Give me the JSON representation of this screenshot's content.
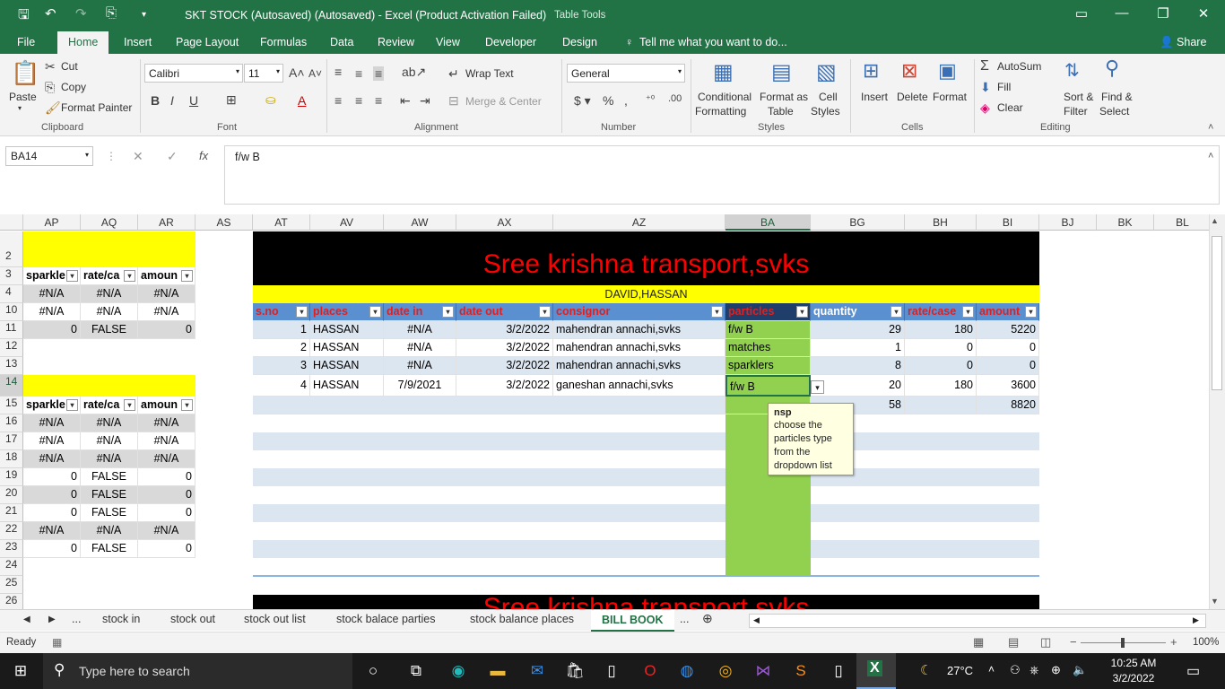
{
  "window": {
    "title": "SKT STOCK (Autosaved) (Autosaved) - Excel (Product Activation Failed)",
    "context_tab": "Table Tools"
  },
  "tabs": [
    "File",
    "Home",
    "Insert",
    "Page Layout",
    "Formulas",
    "Data",
    "Review",
    "View",
    "Developer",
    "Design"
  ],
  "active_tab": "Home",
  "tell_me": "Tell me what you want to do...",
  "share": "Share",
  "ribbon": {
    "clipboard": {
      "paste": "Paste",
      "cut": "Cut",
      "copy": "Copy",
      "format_painter": "Format Painter",
      "group": "Clipboard"
    },
    "font": {
      "name": "Calibri",
      "size": "11",
      "group": "Font"
    },
    "alignment": {
      "wrap": "Wrap Text",
      "merge": "Merge & Center",
      "group": "Alignment"
    },
    "number": {
      "format": "General",
      "group": "Number"
    },
    "styles": {
      "conditional": "Conditional",
      "conditional2": "Formatting",
      "format_as": "Format as",
      "format_as2": "Table",
      "cell": "Cell",
      "cell2": "Styles",
      "group": "Styles"
    },
    "cells": {
      "insert": "Insert",
      "delete": "Delete",
      "format": "Format",
      "group": "Cells"
    },
    "editing": {
      "autosum": "AutoSum",
      "fill": "Fill",
      "clear": "Clear",
      "sort": "Sort &",
      "sort2": "Filter",
      "find": "Find &",
      "find2": "Select",
      "group": "Editing"
    }
  },
  "name_box": "BA14",
  "formula": "f/w B",
  "columns": [
    "AP",
    "AQ",
    "AR",
    "AS",
    "AT",
    "AV",
    "AW",
    "AX",
    "AZ",
    "BA",
    "BG",
    "BH",
    "BI",
    "BJ",
    "BK",
    "BL"
  ],
  "rows": [
    "2",
    "3",
    "4",
    "10",
    "11",
    "12",
    "13",
    "14",
    "15",
    "16",
    "17",
    "18",
    "19",
    "20",
    "21",
    "22",
    "23",
    "24",
    "25",
    "26"
  ],
  "left": {
    "h1": [
      "sparkle",
      "rate/ca",
      "amoun"
    ],
    "r4": [
      "#N/A",
      "#N/A",
      "#N/A"
    ],
    "r10": [
      "#N/A",
      "#N/A",
      "#N/A"
    ],
    "r11": [
      "0",
      "FALSE",
      "0"
    ],
    "h2": [
      "sparkle",
      "rate/ca",
      "amoun"
    ],
    "rows": [
      [
        "#N/A",
        "#N/A",
        "#N/A"
      ],
      [
        "#N/A",
        "#N/A",
        "#N/A"
      ],
      [
        "#N/A",
        "#N/A",
        "#N/A"
      ],
      [
        "0",
        "FALSE",
        "0"
      ],
      [
        "0",
        "FALSE",
        "0"
      ],
      [
        "0",
        "FALSE",
        "0"
      ],
      [
        "#N/A",
        "#N/A",
        "#N/A"
      ],
      [
        "0",
        "FALSE",
        "0"
      ]
    ]
  },
  "bill": {
    "title": "Sree krishna transport,svks",
    "subtitle": "DAVID,HASSAN",
    "headers": [
      "s.no",
      "places",
      "date in",
      "date out",
      "consignor",
      "particles",
      "quantity",
      "rate/case",
      "amount"
    ],
    "rows": [
      [
        "1",
        "HASSAN",
        "#N/A",
        "3/2/2022",
        "mahendran annachi,svks",
        "f/w B",
        "29",
        "180",
        "5220"
      ],
      [
        "2",
        "HASSAN",
        "#N/A",
        "3/2/2022",
        "mahendran annachi,svks",
        "matches",
        "1",
        "0",
        "0"
      ],
      [
        "3",
        "HASSAN",
        "#N/A",
        "3/2/2022",
        "mahendran annachi,svks",
        "sparklers",
        "8",
        "0",
        "0"
      ],
      [
        "4",
        "HASSAN",
        "7/9/2021",
        "3/2/2022",
        "ganeshan annachi,svks",
        "f/w B",
        "20",
        "180",
        "3600"
      ]
    ],
    "total_qty": "58",
    "total_amount": "8820"
  },
  "tooltip": {
    "title": "nsp",
    "body": "choose the particles type from the dropdown list"
  },
  "sheet_tabs": [
    "...",
    "stock in",
    "stock out",
    "stock out list",
    "stock balace parties",
    "stock balance places",
    "BILL BOOK",
    "..."
  ],
  "active_sheet": "BILL BOOK",
  "status": {
    "ready": "Ready",
    "zoom": "100%"
  },
  "taskbar": {
    "search": "Type here to search",
    "temp": "27°C",
    "time": "10:25 AM",
    "date": "3/2/2022"
  }
}
